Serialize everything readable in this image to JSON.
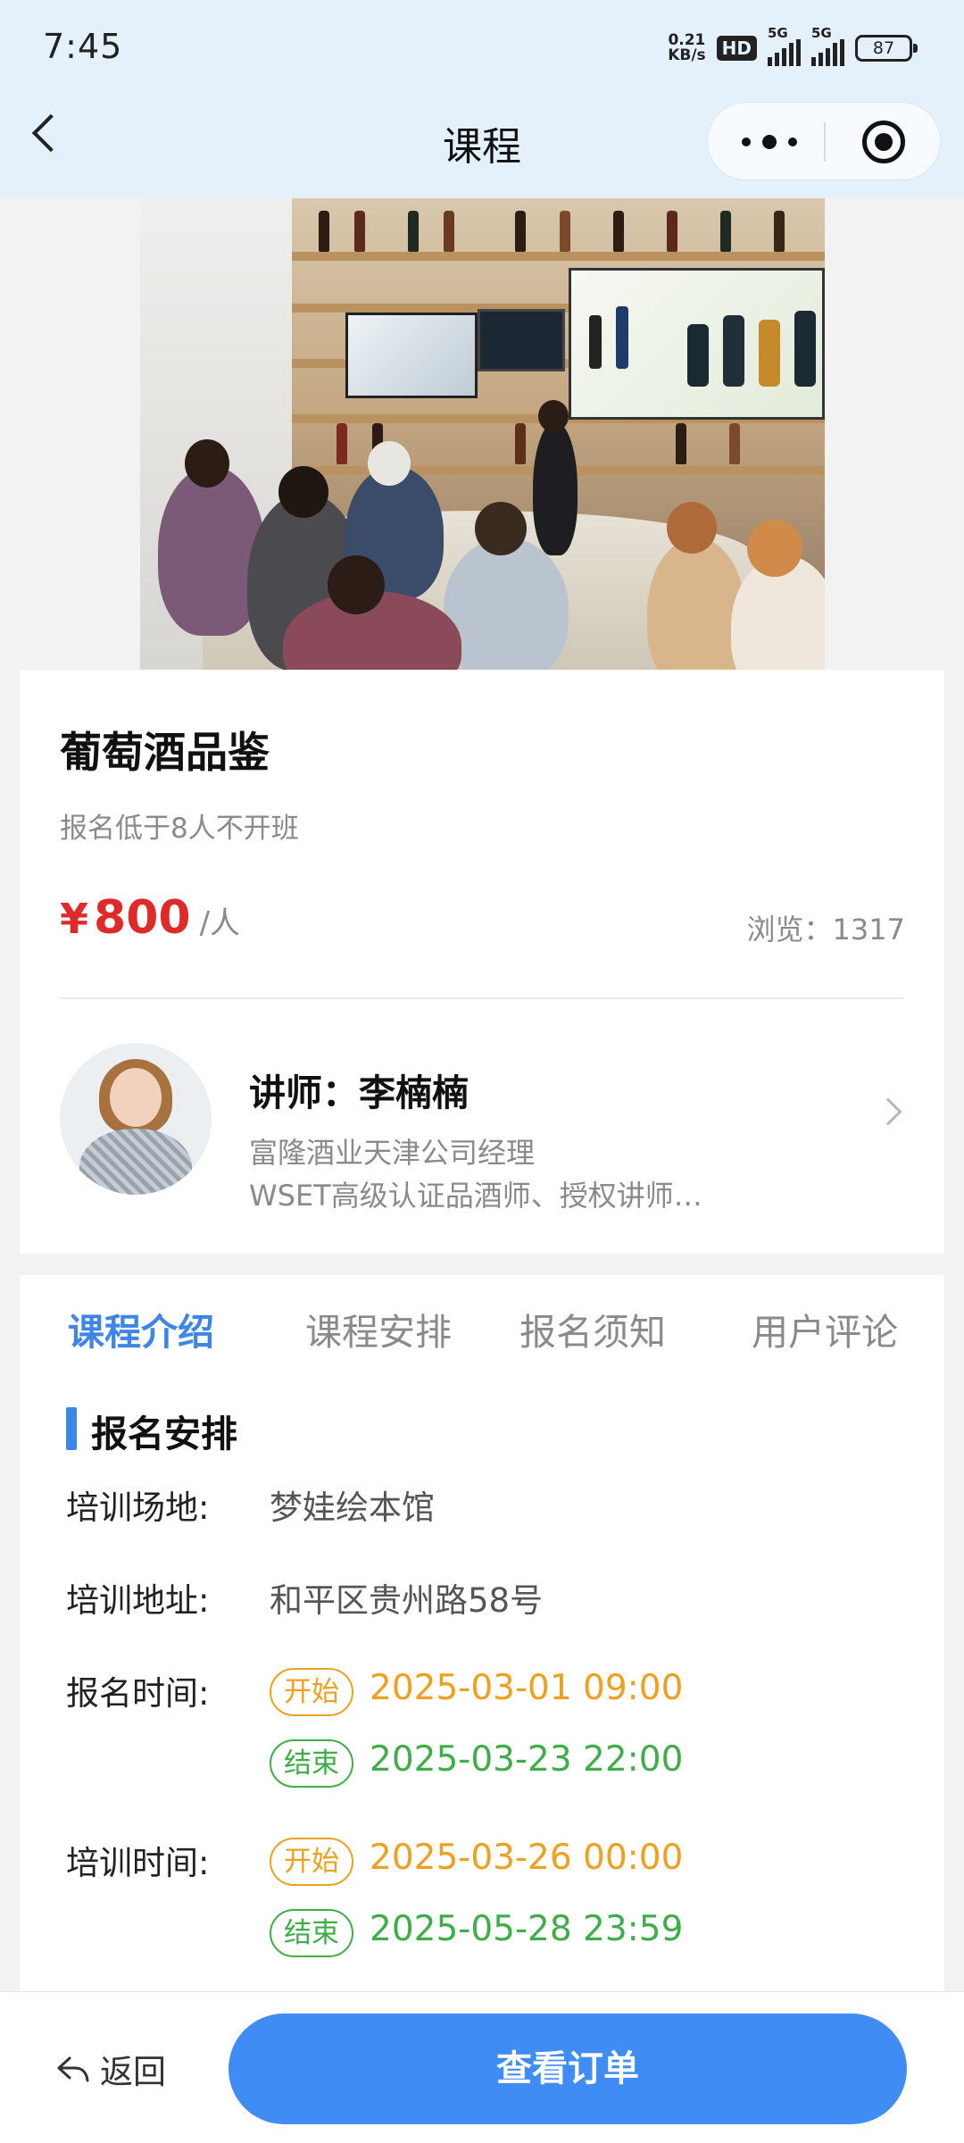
{
  "status_bar": {
    "time": "7:45",
    "net_speed_value": "0.21",
    "net_speed_unit": "KB/s",
    "hd_badge": "HD",
    "signal_1": "5G",
    "signal_2": "5G",
    "battery": "87"
  },
  "nav": {
    "title": "课程",
    "back_icon": "chevron-left-icon",
    "more_icon": "more-dots-icon",
    "close_icon": "target-circle-icon"
  },
  "cover": {
    "icon": "course-cover-photo"
  },
  "course": {
    "title": "葡萄酒品鉴",
    "note": "报名低于8人不开班",
    "currency": "¥",
    "price": "800",
    "price_unit": "/人",
    "views": "浏览：1317"
  },
  "lecturer": {
    "name": "讲师：李楠楠",
    "line1": "富隆酒业天津公司经理",
    "line2": "WSET高级认证品酒师、授权讲师…"
  },
  "tabs": [
    {
      "label": "课程介绍",
      "active": true
    },
    {
      "label": "课程安排",
      "active": false
    },
    {
      "label": "报名须知",
      "active": false
    },
    {
      "label": "用户评论",
      "active": false
    }
  ],
  "section": {
    "title": "报名安排",
    "venue_label": "培训场地:",
    "venue_value": "梦娃绘本馆",
    "address_label": "培训地址:",
    "address_value": "和平区贵州路58号",
    "signup_label": "报名时间:",
    "signup_start_tag": "开始",
    "signup_start": "2025-03-01 09:00",
    "signup_end_tag": "结束",
    "signup_end": "2025-03-23 22:00",
    "training_label": "培训时间:",
    "training_start_tag": "开始",
    "training_start": "2025-03-26 00:00",
    "training_end_tag": "结束",
    "training_end": "2025-05-28 23:59"
  },
  "colors": {
    "accent": "#3f8cf4",
    "price": "#e02a2a",
    "start": "#f0a020",
    "end": "#3fae49",
    "header_bg": "#e4f1fb"
  },
  "bottom": {
    "back_label": "返回",
    "back_icon": "reply-arrow-icon",
    "order_label": "查看订单"
  }
}
